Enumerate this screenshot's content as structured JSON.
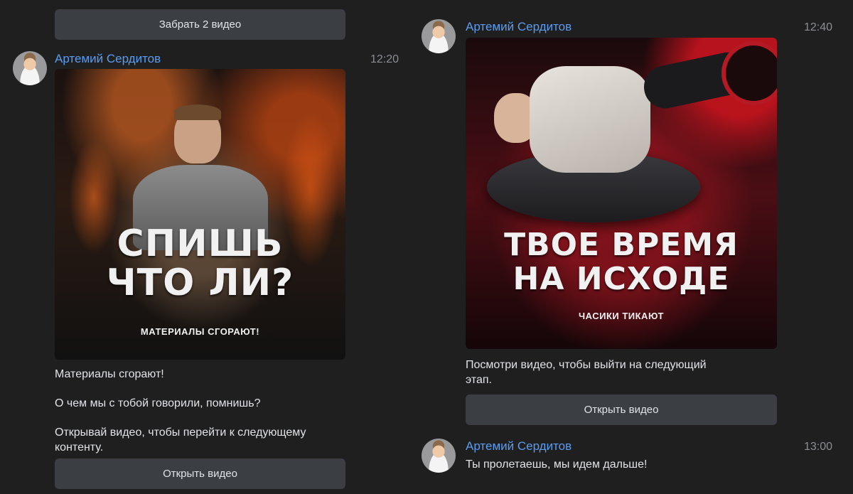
{
  "left": {
    "top_button": "Забрать 2 видео",
    "message": {
      "author": "Артемий Сердитов",
      "time": "12:20",
      "poster": {
        "headline_line1": "СПИШЬ",
        "headline_line2": "ЧТО ЛИ?",
        "subline": "МАТЕРИАЛЫ СГОРАЮТ!"
      },
      "text_lines": [
        "Материалы сгорают!",
        "О чем мы с тобой говорили, помнишь?",
        "Открывай видео, чтобы перейти к следующему",
        "контенту."
      ],
      "button": "Открыть видео"
    }
  },
  "right": {
    "message1": {
      "author": "Артемий Сердитов",
      "time": "12:40",
      "poster": {
        "headline_line1": "ТВОЕ ВРЕМЯ",
        "headline_line2": "НА ИСХОДЕ",
        "subline": "ЧАСИКИ ТИКАЮТ"
      },
      "text_line1": "Посмотри видео, чтобы выйти на  следующий",
      "text_line2": "этап.",
      "button": "Открыть видео"
    },
    "message2": {
      "author": "Артемий Сердитов",
      "time": "13:00",
      "text": "Ты пролетаешь, мы идем дальше!"
    }
  },
  "colors": {
    "background": "#1f1f20",
    "author_link": "#5a9cf0",
    "button_bg": "#3b3f44",
    "timestamp": "#8b8e93"
  }
}
